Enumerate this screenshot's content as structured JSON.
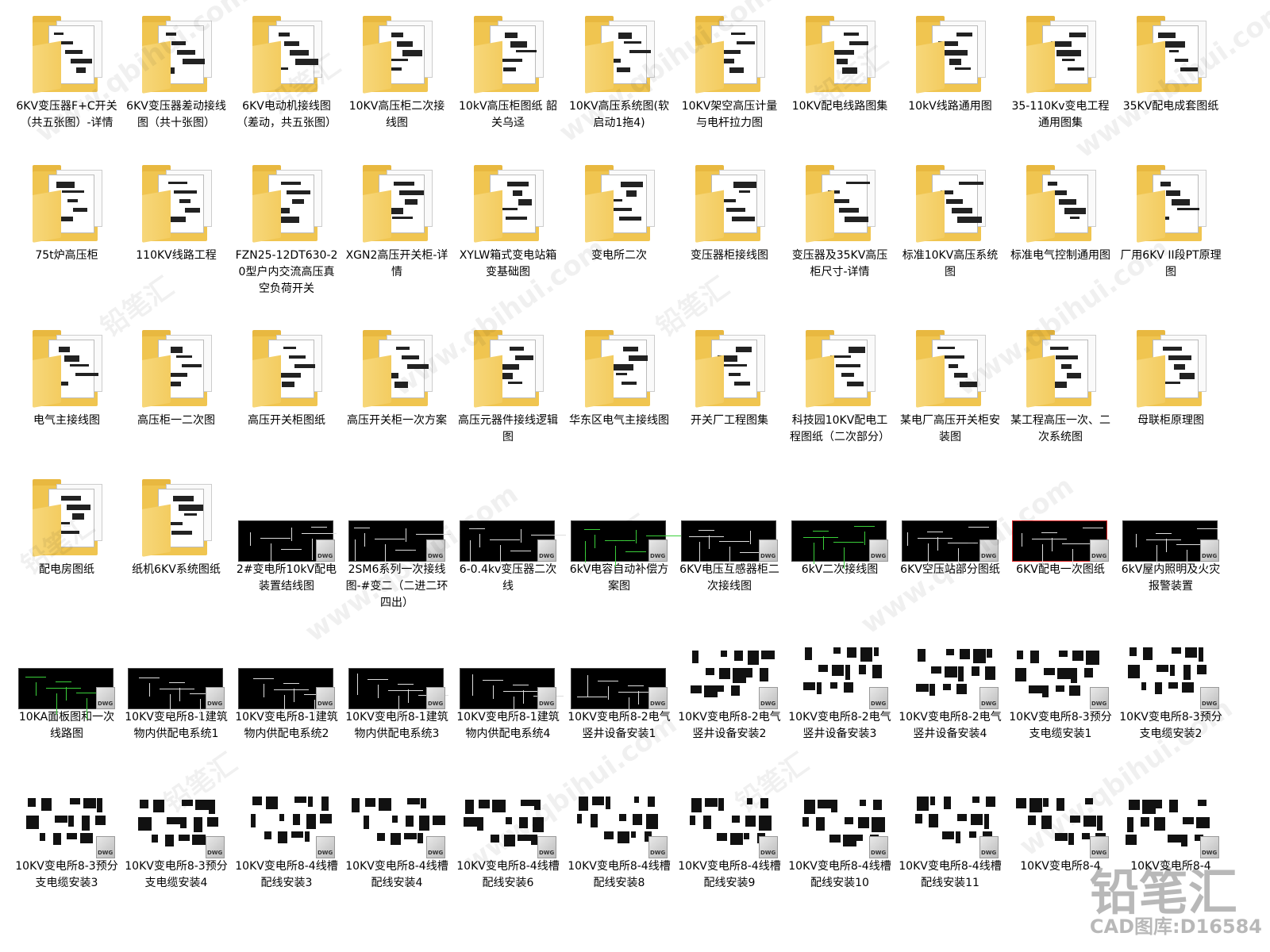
{
  "items": [
    {
      "type": "folder",
      "label": "6KV变压器F+C开关（共五张图）-详情"
    },
    {
      "type": "folder",
      "label": "6KV变压器差动接线图（共十张图）"
    },
    {
      "type": "folder",
      "label": "6KV电动机接线图（差动，共五张图）"
    },
    {
      "type": "folder",
      "label": "10KV高压柜二次接线图"
    },
    {
      "type": "folder",
      "label": "10kV高压柜图纸 韶关乌迳"
    },
    {
      "type": "folder",
      "label": "10KV高压系统图(软启动1拖4)"
    },
    {
      "type": "folder",
      "label": "10KV架空高压计量与电杆拉力图"
    },
    {
      "type": "folder",
      "label": "10KV配电线路图集"
    },
    {
      "type": "folder",
      "label": "10kV线路通用图"
    },
    {
      "type": "folder",
      "label": "35-110Kv变电工程通用图集"
    },
    {
      "type": "folder",
      "label": "35KV配电成套图纸"
    },
    {
      "type": "folder",
      "label": "75t炉高压柜"
    },
    {
      "type": "folder",
      "label": "110KV线路工程"
    },
    {
      "type": "folder",
      "label": "FZN25-12DT630-20型户内交流高压真空负荷开关"
    },
    {
      "type": "folder",
      "label": "XGN2高压开关柜-详情"
    },
    {
      "type": "folder",
      "label": "XYLW箱式变电站箱变基础图"
    },
    {
      "type": "folder",
      "label": "变电所二次"
    },
    {
      "type": "folder",
      "label": "变压器柜接线图"
    },
    {
      "type": "folder",
      "label": "变压器及35KV高压柜尺寸-详情"
    },
    {
      "type": "folder",
      "label": "标准10KV高压系统图"
    },
    {
      "type": "folder",
      "label": "标准电气控制通用图"
    },
    {
      "type": "folder",
      "label": "厂用6KV II段PT原理图"
    },
    {
      "type": "folder",
      "label": "电气主接线图"
    },
    {
      "type": "folder",
      "label": "高压柜一二次图"
    },
    {
      "type": "folder",
      "label": "高压开关柜图纸"
    },
    {
      "type": "folder",
      "label": "高压开关柜一次方案"
    },
    {
      "type": "folder",
      "label": "高压元器件接线逻辑图"
    },
    {
      "type": "folder",
      "label": "华东区电气主接线图"
    },
    {
      "type": "folder",
      "label": "开关厂工程图集"
    },
    {
      "type": "folder",
      "label": "科技园10KV配电工程图纸（二次部分）"
    },
    {
      "type": "folder",
      "label": "某电厂高压开关柜安装图"
    },
    {
      "type": "folder",
      "label": "某工程高压一次、二次系统图"
    },
    {
      "type": "folder",
      "label": "母联柜原理图"
    },
    {
      "type": "folder",
      "label": "配电房图纸"
    },
    {
      "type": "folder",
      "label": "纸机6KV系统图纸"
    },
    {
      "type": "dwg",
      "label": "2#变电所10kV配电装置结线图"
    },
    {
      "type": "dwg",
      "label": "2SM6系列一次接线图-#变二（二进二环四出）"
    },
    {
      "type": "dwg",
      "label": "6-0.4kv变压器二次线"
    },
    {
      "type": "dwg-green",
      "label": "6kV电容自动补偿方案图"
    },
    {
      "type": "dwg",
      "label": "6KV电压互感器柜二次接线图"
    },
    {
      "type": "dwg-green",
      "label": "6kV二次接线图"
    },
    {
      "type": "dwg",
      "label": "6KV空压站部分图纸"
    },
    {
      "type": "dwg-red",
      "label": "6KV配电一次图纸"
    },
    {
      "type": "dwg",
      "label": "6kV屋内照明及火灾报警装置"
    },
    {
      "type": "dwg-green",
      "label": "10KA面板图和一次线路图"
    },
    {
      "type": "dwg",
      "label": "10KV变电所8-1建筑物内供配电系统1"
    },
    {
      "type": "dwg",
      "label": "10KV变电所8-1建筑物内供配电系统2"
    },
    {
      "type": "dwg",
      "label": "10KV变电所8-1建筑物内供配电系统3"
    },
    {
      "type": "dwg",
      "label": "10KV变电所8-1建筑物内供配电系统4"
    },
    {
      "type": "dwg",
      "label": "10KV变电所8-2电气竖井设备安装1"
    },
    {
      "type": "white",
      "label": "10KV变电所8-2电气竖井设备安装2"
    },
    {
      "type": "white",
      "label": "10KV变电所8-2电气竖井设备安装3"
    },
    {
      "type": "white",
      "label": "10KV变电所8-2电气竖井设备安装4"
    },
    {
      "type": "white",
      "label": "10KV变电所8-3预分支电缆安装1"
    },
    {
      "type": "white",
      "label": "10KV变电所8-3预分支电缆安装2"
    },
    {
      "type": "white",
      "label": "10KV变电所8-3预分支电缆安装3"
    },
    {
      "type": "white",
      "label": "10KV变电所8-3预分支电缆安装4"
    },
    {
      "type": "white",
      "label": "10KV变电所8-4线槽配线安装3"
    },
    {
      "type": "white",
      "label": "10KV变电所8-4线槽配线安装4"
    },
    {
      "type": "white",
      "label": "10KV变电所8-4线槽配线安装6"
    },
    {
      "type": "white",
      "label": "10KV变电所8-4线槽配线安装8"
    },
    {
      "type": "white",
      "label": "10KV变电所8-4线槽配线安装9"
    },
    {
      "type": "white",
      "label": "10KV变电所8-4线槽配线安装10"
    },
    {
      "type": "white",
      "label": "10KV变电所8-4线槽配线安装11"
    },
    {
      "type": "white",
      "label": "10KV变电所8-4"
    },
    {
      "type": "white",
      "label": "10KV变电所8-4"
    }
  ],
  "dwg_badge": "DWG",
  "watermark": "www.qbihui.com",
  "watermark_cn": "铅笔汇",
  "brand": {
    "main": "铅笔汇",
    "sub": "CAD图库:D16584"
  }
}
